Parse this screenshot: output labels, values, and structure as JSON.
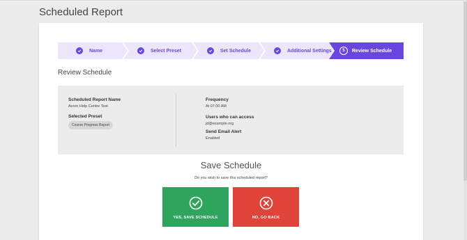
{
  "page": {
    "title": "Scheduled Report"
  },
  "stepper": {
    "steps": [
      {
        "label": "Name",
        "status": "done"
      },
      {
        "label": "Select Preset",
        "status": "done"
      },
      {
        "label": "Set Schedule",
        "status": "done"
      },
      {
        "label": "Additional Settings",
        "status": "done"
      },
      {
        "label": "Review Schedule",
        "status": "active",
        "number": "5"
      }
    ]
  },
  "review": {
    "title": "Review Schedule",
    "report_name_label": "Scheduled Report Name",
    "report_name_value": "Acorn Help Centre Test",
    "preset_label": "Selected Preset",
    "preset_value": "Course Progress Report",
    "frequency_label": "Frequency",
    "frequency_value": "At 07:00 AM",
    "access_label": "Users who can access",
    "access_value": "jd@example.org",
    "email_label": "Send Email Alert",
    "email_value": "Enabled"
  },
  "save": {
    "title": "Save Schedule",
    "question": "Do you wish to save this scheduled report?",
    "yes_label": "YES, SAVE SCHEDULE",
    "no_label": "NO, GO BACK"
  },
  "colors": {
    "accent": "#6a46e0",
    "step_bg": "#ece6fb",
    "yes": "#2fa45c",
    "no": "#e04438"
  }
}
